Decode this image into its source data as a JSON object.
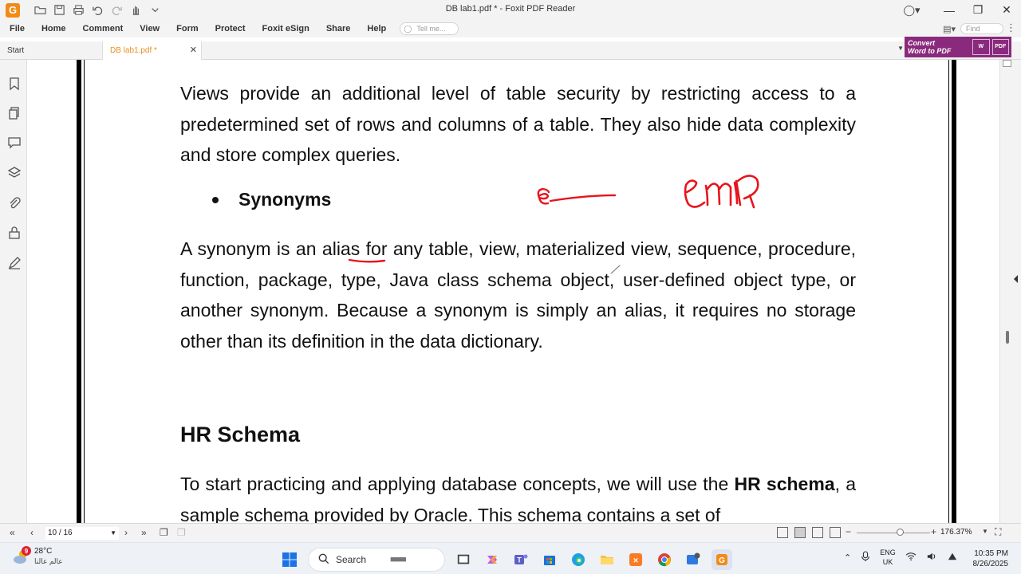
{
  "app": {
    "title": "DB lab1.pdf * - Foxit PDF Reader",
    "logo": "G"
  },
  "menu": {
    "items": [
      "File",
      "Home",
      "Comment",
      "View",
      "Form",
      "Protect",
      "Foxit eSign",
      "Share",
      "Help"
    ],
    "tell_me_placeholder": "Tell me...",
    "find_placeholder": "Find"
  },
  "tabs": {
    "start": "Start",
    "doc": "DB lab1.pdf *"
  },
  "promo": {
    "line1": "Convert",
    "line2": "Word to PDF",
    "icon_w": "W",
    "icon_pdf": "PDF"
  },
  "document": {
    "para1": "Views provide an additional level of table security by restricting access to a predetermined set of rows and columns of a table. They also hide data complexity and store complex queries.",
    "bullet": "Synonyms",
    "para2_before": "A synonym is an ",
    "para2_alias": "alias",
    "para2_after": " for any table, view, materialized view, sequence, procedure, function, package, type, Java class schema object, user-defined object type, or another synonym. Because a synonym is simply an alias, it requires no storage other than its definition in the data dictionary.",
    "heading": "HR Schema",
    "para3_before": "To start practicing and applying database concepts, we will use the ",
    "para3_bold": "HR schema",
    "para3_after": ", a sample schema provided by Oracle. This schema contains a set of"
  },
  "ink": {
    "color": "#e8141c"
  },
  "statusbar": {
    "page": "10 / 16",
    "zoom": "176.37%"
  },
  "taskbar": {
    "temperature": "28°C",
    "weather_sub": "عالم عالنا",
    "weather_badge": "9",
    "search_label": "Search",
    "lang_line1": "ENG",
    "lang_line2": "UK",
    "time": "10:35 PM",
    "date": "8/26/2025"
  }
}
